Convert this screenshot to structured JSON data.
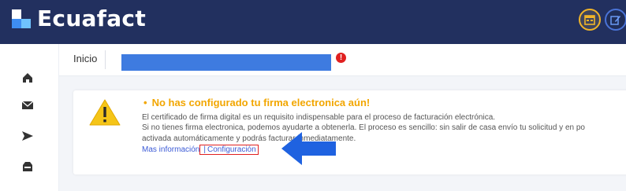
{
  "app": {
    "brand": "Ecuafact"
  },
  "header": {
    "actions": [
      {
        "name": "calendar",
        "icon": "calendar-icon"
      },
      {
        "name": "edit",
        "icon": "edit-icon"
      }
    ]
  },
  "sidebar": {
    "items": [
      {
        "icon": "home-icon"
      },
      {
        "icon": "mail-icon"
      },
      {
        "icon": "send-icon"
      },
      {
        "icon": "inbox-icon"
      }
    ]
  },
  "breadcrumb": {
    "label": "Inicio",
    "error_badge": "!"
  },
  "alert": {
    "title": "No has configurado tu firma electronica aún!",
    "line1": "El certificado de firma digital es un requisito indispensable para el proceso de facturación electrónica.",
    "line2": "Si no tienes firma electronica, podemos ayudarte a obtenerla. El proceso es sencillo: sin salir de casa envío tu solicitud y en po",
    "line3": "activada automáticamente y podrás facturar inmediatamente.",
    "link_more": "Mas información",
    "link_separator": "|",
    "link_config": "Configuración"
  },
  "colors": {
    "topbar": "#22305f",
    "warning": "#f2a600",
    "link": "#3c5bd6",
    "highlight": "#3e7be0",
    "error": "#e02020"
  }
}
